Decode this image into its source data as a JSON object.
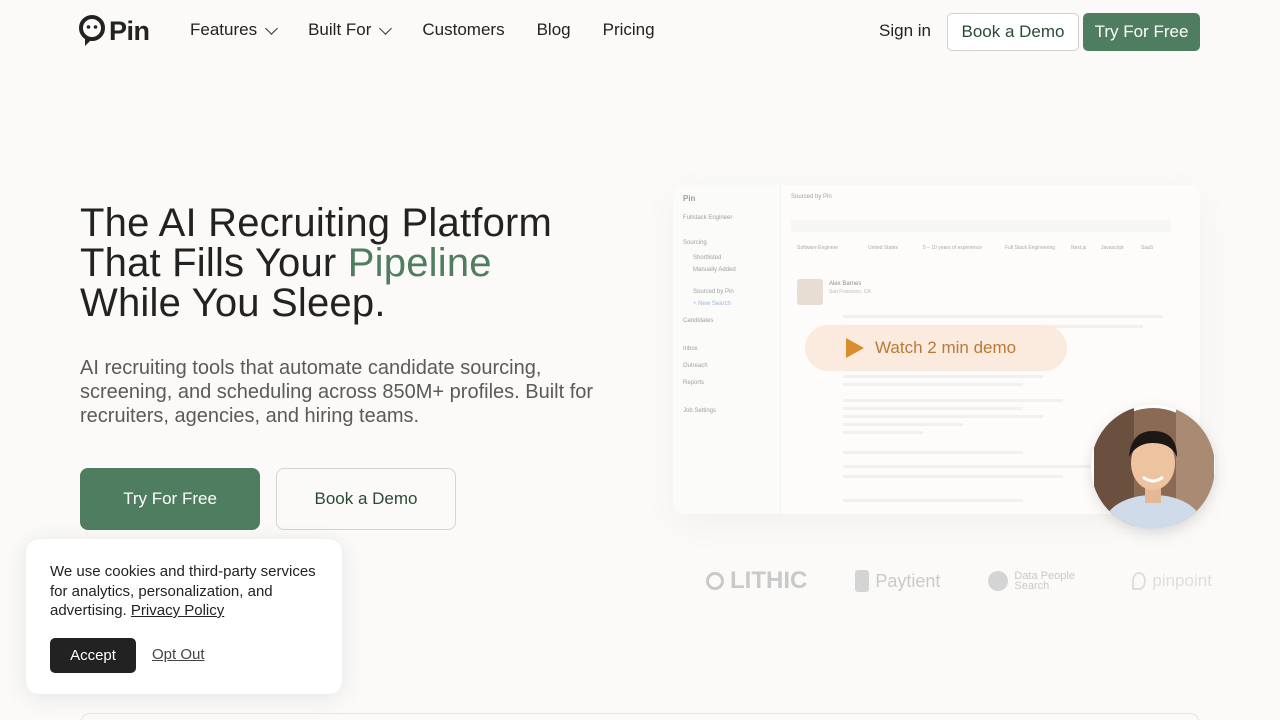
{
  "nav": {
    "logo_text": "Pin",
    "links": [
      {
        "label": "Features",
        "has_dropdown": true
      },
      {
        "label": "Built For",
        "has_dropdown": true
      },
      {
        "label": "Customers",
        "has_dropdown": false
      },
      {
        "label": "Blog",
        "has_dropdown": false
      },
      {
        "label": "Pricing",
        "has_dropdown": false
      }
    ],
    "signin": "Sign in",
    "book_demo": "Book a Demo",
    "try_free": "Try For Free"
  },
  "hero": {
    "title_line1": "The AI Recruiting Platform",
    "title_line2_pre": "That Fills Your ",
    "title_line2_accent": "Pipeline",
    "title_line3": "While You Sleep.",
    "subtitle": "AI recruiting tools that automate candidate sourcing, screening, and scheduling across 850M+ profiles. Built for recruiters, agencies, and hiring teams.",
    "cta_primary": "Try For Free",
    "cta_secondary": "Book a Demo"
  },
  "app_preview": {
    "brand": "Pin",
    "job": "Fullstack Engineer",
    "sidebar": [
      "Sourcing",
      "Shortlisted",
      "Manually Added",
      "Sourced by Pin",
      "+ New Search",
      "Candidates",
      "Inbox",
      "Outreach",
      "Reports",
      "Job Settings"
    ],
    "header": "Sourced by Pin",
    "candidate_name": "Alex Barnes",
    "candidate_location": "San Francisco, CA",
    "filters": [
      "Software Engineer",
      "United States",
      "5 – 10 years of experience",
      "Full Stack Engineering",
      "Next.js",
      "Javascript",
      "SaaS"
    ],
    "watch_label": "Watch 2 min demo"
  },
  "logos": [
    "LITHIC",
    "Paytient",
    "Data People Search",
    "pinpoint"
  ],
  "cookie": {
    "text": "We use cookies and third-party services for analytics, personalization, and advertising.",
    "policy_link": "Privacy Policy",
    "accept": "Accept",
    "opt_out": "Opt Out"
  },
  "colors": {
    "brand_green": "#4f7d5f",
    "background": "#fbfaf8",
    "demo_orange": "#d98d2f"
  }
}
